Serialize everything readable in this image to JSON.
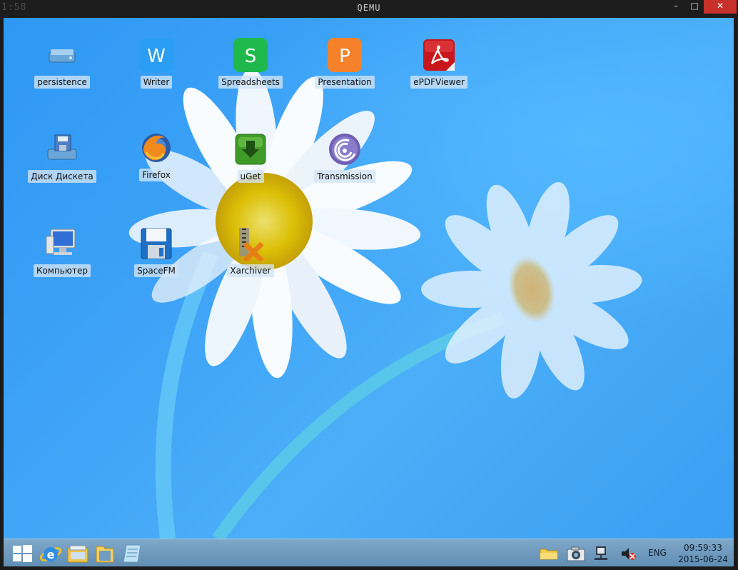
{
  "host": {
    "clock": "1:58"
  },
  "window": {
    "title": "QEMU",
    "minimize": "–",
    "maximize": "□",
    "close": "✕"
  },
  "desktop": {
    "icons": [
      {
        "label": "persistence",
        "icon": "drive-icon"
      },
      {
        "label": "Writer",
        "icon": "wps-writer-icon"
      },
      {
        "label": "Spreadsheets",
        "icon": "wps-spreadsheets-icon"
      },
      {
        "label": "Presentation",
        "icon": "wps-presentation-icon"
      },
      {
        "label": "ePDFViewer",
        "icon": "pdf-icon"
      },
      {
        "label": "Диск Дискета",
        "icon": "floppy-drive-icon"
      },
      {
        "label": "Firefox",
        "icon": "firefox-icon"
      },
      {
        "label": "uGet",
        "icon": "uget-icon"
      },
      {
        "label": "Transmission",
        "icon": "transmission-icon"
      },
      {
        "label": "Компьютер",
        "icon": "computer-icon"
      },
      {
        "label": "SpaceFM",
        "icon": "floppy-save-icon"
      },
      {
        "label": "Xarchiver",
        "icon": "xarchiver-icon"
      }
    ]
  },
  "taskbar": {
    "pinned": [
      "start-icon",
      "internet-explorer-icon",
      "file-manager-icon",
      "folder-icon",
      "notepad-icon"
    ],
    "tray": [
      "folder-tray-icon",
      "camera-icon",
      "network-icon",
      "volume-muted-icon"
    ],
    "language": "ENG",
    "time": "09:59:33",
    "date": "2015-06-24"
  },
  "colors": {
    "wallpaper": "#3ea3f7",
    "taskbar": "#6f9bbf",
    "close_button": "#c7312a"
  }
}
